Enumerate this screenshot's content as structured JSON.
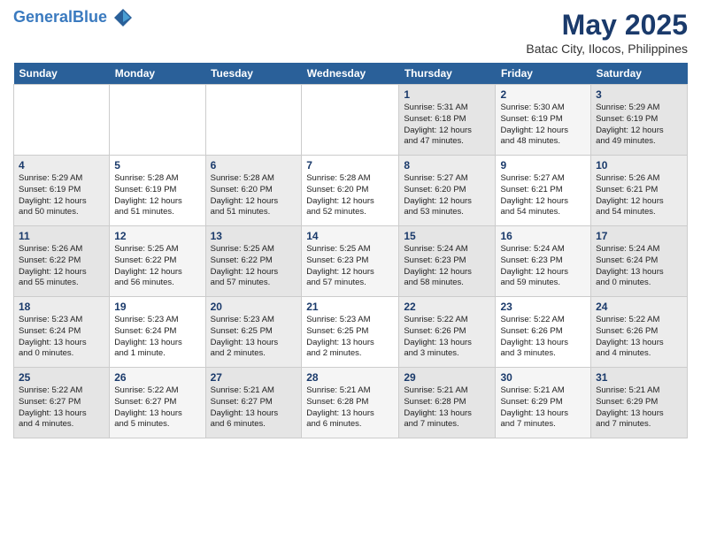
{
  "header": {
    "logo_line1": "General",
    "logo_line2": "Blue",
    "month": "May 2025",
    "location": "Batac City, Ilocos, Philippines"
  },
  "weekdays": [
    "Sunday",
    "Monday",
    "Tuesday",
    "Wednesday",
    "Thursday",
    "Friday",
    "Saturday"
  ],
  "weeks": [
    [
      {
        "day": "",
        "info": ""
      },
      {
        "day": "",
        "info": ""
      },
      {
        "day": "",
        "info": ""
      },
      {
        "day": "",
        "info": ""
      },
      {
        "day": "1",
        "info": "Sunrise: 5:31 AM\nSunset: 6:18 PM\nDaylight: 12 hours\nand 47 minutes."
      },
      {
        "day": "2",
        "info": "Sunrise: 5:30 AM\nSunset: 6:19 PM\nDaylight: 12 hours\nand 48 minutes."
      },
      {
        "day": "3",
        "info": "Sunrise: 5:29 AM\nSunset: 6:19 PM\nDaylight: 12 hours\nand 49 minutes."
      }
    ],
    [
      {
        "day": "4",
        "info": "Sunrise: 5:29 AM\nSunset: 6:19 PM\nDaylight: 12 hours\nand 50 minutes."
      },
      {
        "day": "5",
        "info": "Sunrise: 5:28 AM\nSunset: 6:19 PM\nDaylight: 12 hours\nand 51 minutes."
      },
      {
        "day": "6",
        "info": "Sunrise: 5:28 AM\nSunset: 6:20 PM\nDaylight: 12 hours\nand 51 minutes."
      },
      {
        "day": "7",
        "info": "Sunrise: 5:28 AM\nSunset: 6:20 PM\nDaylight: 12 hours\nand 52 minutes."
      },
      {
        "day": "8",
        "info": "Sunrise: 5:27 AM\nSunset: 6:20 PM\nDaylight: 12 hours\nand 53 minutes."
      },
      {
        "day": "9",
        "info": "Sunrise: 5:27 AM\nSunset: 6:21 PM\nDaylight: 12 hours\nand 54 minutes."
      },
      {
        "day": "10",
        "info": "Sunrise: 5:26 AM\nSunset: 6:21 PM\nDaylight: 12 hours\nand 54 minutes."
      }
    ],
    [
      {
        "day": "11",
        "info": "Sunrise: 5:26 AM\nSunset: 6:22 PM\nDaylight: 12 hours\nand 55 minutes."
      },
      {
        "day": "12",
        "info": "Sunrise: 5:25 AM\nSunset: 6:22 PM\nDaylight: 12 hours\nand 56 minutes."
      },
      {
        "day": "13",
        "info": "Sunrise: 5:25 AM\nSunset: 6:22 PM\nDaylight: 12 hours\nand 57 minutes."
      },
      {
        "day": "14",
        "info": "Sunrise: 5:25 AM\nSunset: 6:23 PM\nDaylight: 12 hours\nand 57 minutes."
      },
      {
        "day": "15",
        "info": "Sunrise: 5:24 AM\nSunset: 6:23 PM\nDaylight: 12 hours\nand 58 minutes."
      },
      {
        "day": "16",
        "info": "Sunrise: 5:24 AM\nSunset: 6:23 PM\nDaylight: 12 hours\nand 59 minutes."
      },
      {
        "day": "17",
        "info": "Sunrise: 5:24 AM\nSunset: 6:24 PM\nDaylight: 13 hours\nand 0 minutes."
      }
    ],
    [
      {
        "day": "18",
        "info": "Sunrise: 5:23 AM\nSunset: 6:24 PM\nDaylight: 13 hours\nand 0 minutes."
      },
      {
        "day": "19",
        "info": "Sunrise: 5:23 AM\nSunset: 6:24 PM\nDaylight: 13 hours\nand 1 minute."
      },
      {
        "day": "20",
        "info": "Sunrise: 5:23 AM\nSunset: 6:25 PM\nDaylight: 13 hours\nand 2 minutes."
      },
      {
        "day": "21",
        "info": "Sunrise: 5:23 AM\nSunset: 6:25 PM\nDaylight: 13 hours\nand 2 minutes."
      },
      {
        "day": "22",
        "info": "Sunrise: 5:22 AM\nSunset: 6:26 PM\nDaylight: 13 hours\nand 3 minutes."
      },
      {
        "day": "23",
        "info": "Sunrise: 5:22 AM\nSunset: 6:26 PM\nDaylight: 13 hours\nand 3 minutes."
      },
      {
        "day": "24",
        "info": "Sunrise: 5:22 AM\nSunset: 6:26 PM\nDaylight: 13 hours\nand 4 minutes."
      }
    ],
    [
      {
        "day": "25",
        "info": "Sunrise: 5:22 AM\nSunset: 6:27 PM\nDaylight: 13 hours\nand 4 minutes."
      },
      {
        "day": "26",
        "info": "Sunrise: 5:22 AM\nSunset: 6:27 PM\nDaylight: 13 hours\nand 5 minutes."
      },
      {
        "day": "27",
        "info": "Sunrise: 5:21 AM\nSunset: 6:27 PM\nDaylight: 13 hours\nand 6 minutes."
      },
      {
        "day": "28",
        "info": "Sunrise: 5:21 AM\nSunset: 6:28 PM\nDaylight: 13 hours\nand 6 minutes."
      },
      {
        "day": "29",
        "info": "Sunrise: 5:21 AM\nSunset: 6:28 PM\nDaylight: 13 hours\nand 7 minutes."
      },
      {
        "day": "30",
        "info": "Sunrise: 5:21 AM\nSunset: 6:29 PM\nDaylight: 13 hours\nand 7 minutes."
      },
      {
        "day": "31",
        "info": "Sunrise: 5:21 AM\nSunset: 6:29 PM\nDaylight: 13 hours\nand 7 minutes."
      }
    ]
  ]
}
